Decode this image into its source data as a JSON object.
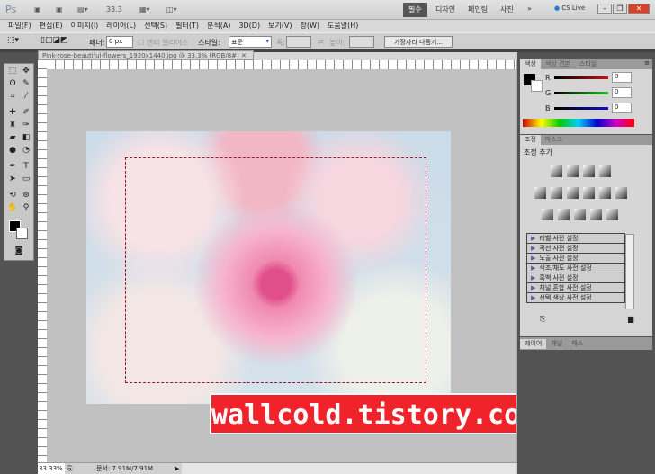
{
  "titlebar": {
    "logo": "Ps",
    "zoom": "33.3",
    "workspaces": [
      "필수",
      "디자인",
      "페인팅",
      "사진"
    ],
    "more": "»",
    "cslive": "CS Live"
  },
  "menu": [
    "파일(F)",
    "편집(E)",
    "이미지(I)",
    "레이어(L)",
    "선택(S)",
    "필터(T)",
    "분석(A)",
    "3D(D)",
    "보기(V)",
    "창(W)",
    "도움말(H)"
  ],
  "options": {
    "feather_label": "페더:",
    "feather_value": "0 px",
    "antialias": "앤티 앨리어스",
    "style_label": "스타일:",
    "style_value": "표준",
    "width_label": "폭:",
    "height_label": "높이:",
    "refine_button": "가장자리 다듬기..."
  },
  "document": {
    "tab": "Pink-rose-beautiful-flowers_1920x1440.jpg @ 33.3% (RGB/8#)",
    "zoom": "33.33%",
    "doc_info": "문서: 7.91M/7.91M"
  },
  "watermark": "wallcold.tistory.com",
  "color_panel": {
    "tabs": [
      "색상",
      "색상 견본",
      "스타일"
    ],
    "channels": [
      {
        "label": "R",
        "value": "0",
        "color": "#d01010"
      },
      {
        "label": "G",
        "value": "0",
        "color": "#20c020"
      },
      {
        "label": "B",
        "value": "0",
        "color": "#1010c0"
      }
    ]
  },
  "adjust_panel": {
    "tabs": [
      "조정",
      "마스크"
    ],
    "heading": "조정 추가",
    "presets": [
      "레벨 사전 설정",
      "곡선 사전 설정",
      "노출 사전 설정",
      "색조/채도 사전 설정",
      "흑백 사전 설정",
      "채널 혼합 사전 설정",
      "선택 색상 사전 설정"
    ]
  },
  "layers_panel": {
    "tabs": [
      "레이어",
      "채널",
      "패스"
    ]
  }
}
